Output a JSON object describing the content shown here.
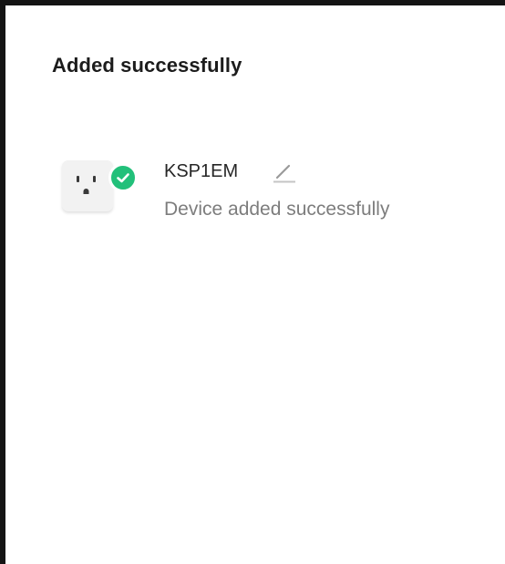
{
  "page": {
    "title": "Added successfully"
  },
  "device": {
    "name": "KSP1EM",
    "status": "Device added successfully",
    "icon": "smart-plug-icon",
    "badge_icon": "check-icon",
    "edit_icon": "pencil-icon"
  },
  "colors": {
    "badge": "#22c07a",
    "title": "#1c1c1c",
    "status_text": "#7d7d7d"
  }
}
